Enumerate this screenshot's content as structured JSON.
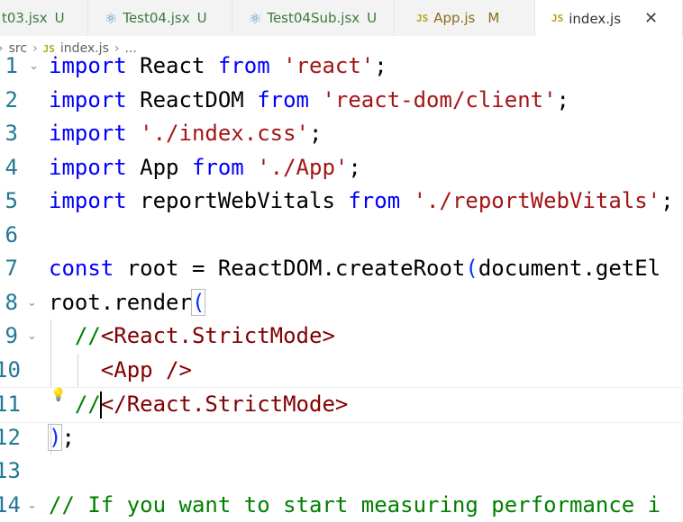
{
  "tabs": [
    {
      "label": "t03.jsx",
      "status": "U",
      "icon": "none"
    },
    {
      "label": "Test04.jsx",
      "status": "U",
      "icon": "react-icon"
    },
    {
      "label": "Test04Sub.jsx",
      "status": "U",
      "icon": "react-icon"
    },
    {
      "label": "App.js",
      "status": "M",
      "icon": "js-icon"
    },
    {
      "label": "index.js",
      "status": "",
      "icon": "js-icon",
      "active": true
    }
  ],
  "breadcrumb": {
    "items": [
      "src",
      "index.js",
      "..."
    ],
    "file_icon_text": "JS"
  },
  "tab_icon_text": "JS",
  "editor": {
    "lines": [
      {
        "n": "1",
        "text": "import React from 'react';"
      },
      {
        "n": "2",
        "text": "import ReactDOM from 'react-dom/client';"
      },
      {
        "n": "3",
        "text": "import './index.css';"
      },
      {
        "n": "4",
        "text": "import App from './App';"
      },
      {
        "n": "5",
        "text": "import reportWebVitals from './reportWebVitals';"
      },
      {
        "n": "6",
        "text": ""
      },
      {
        "n": "7",
        "text": "const root = ReactDOM.createRoot(document.getEl"
      },
      {
        "n": "8",
        "text": "root.render("
      },
      {
        "n": "9",
        "text": "  //<React.StrictMode>"
      },
      {
        "n": "10",
        "text": "    <App />"
      },
      {
        "n": "11",
        "text": "  //</React.StrictMode>"
      },
      {
        "n": "12",
        "text": ");"
      },
      {
        "n": "13",
        "text": ""
      },
      {
        "n": "14",
        "text": "// If you want to start measuring performance i"
      }
    ]
  },
  "colors": {
    "keyword": "#0000ff",
    "string": "#a31515",
    "comment": "#008000",
    "tag": "#800000",
    "line_number": "#237893"
  }
}
